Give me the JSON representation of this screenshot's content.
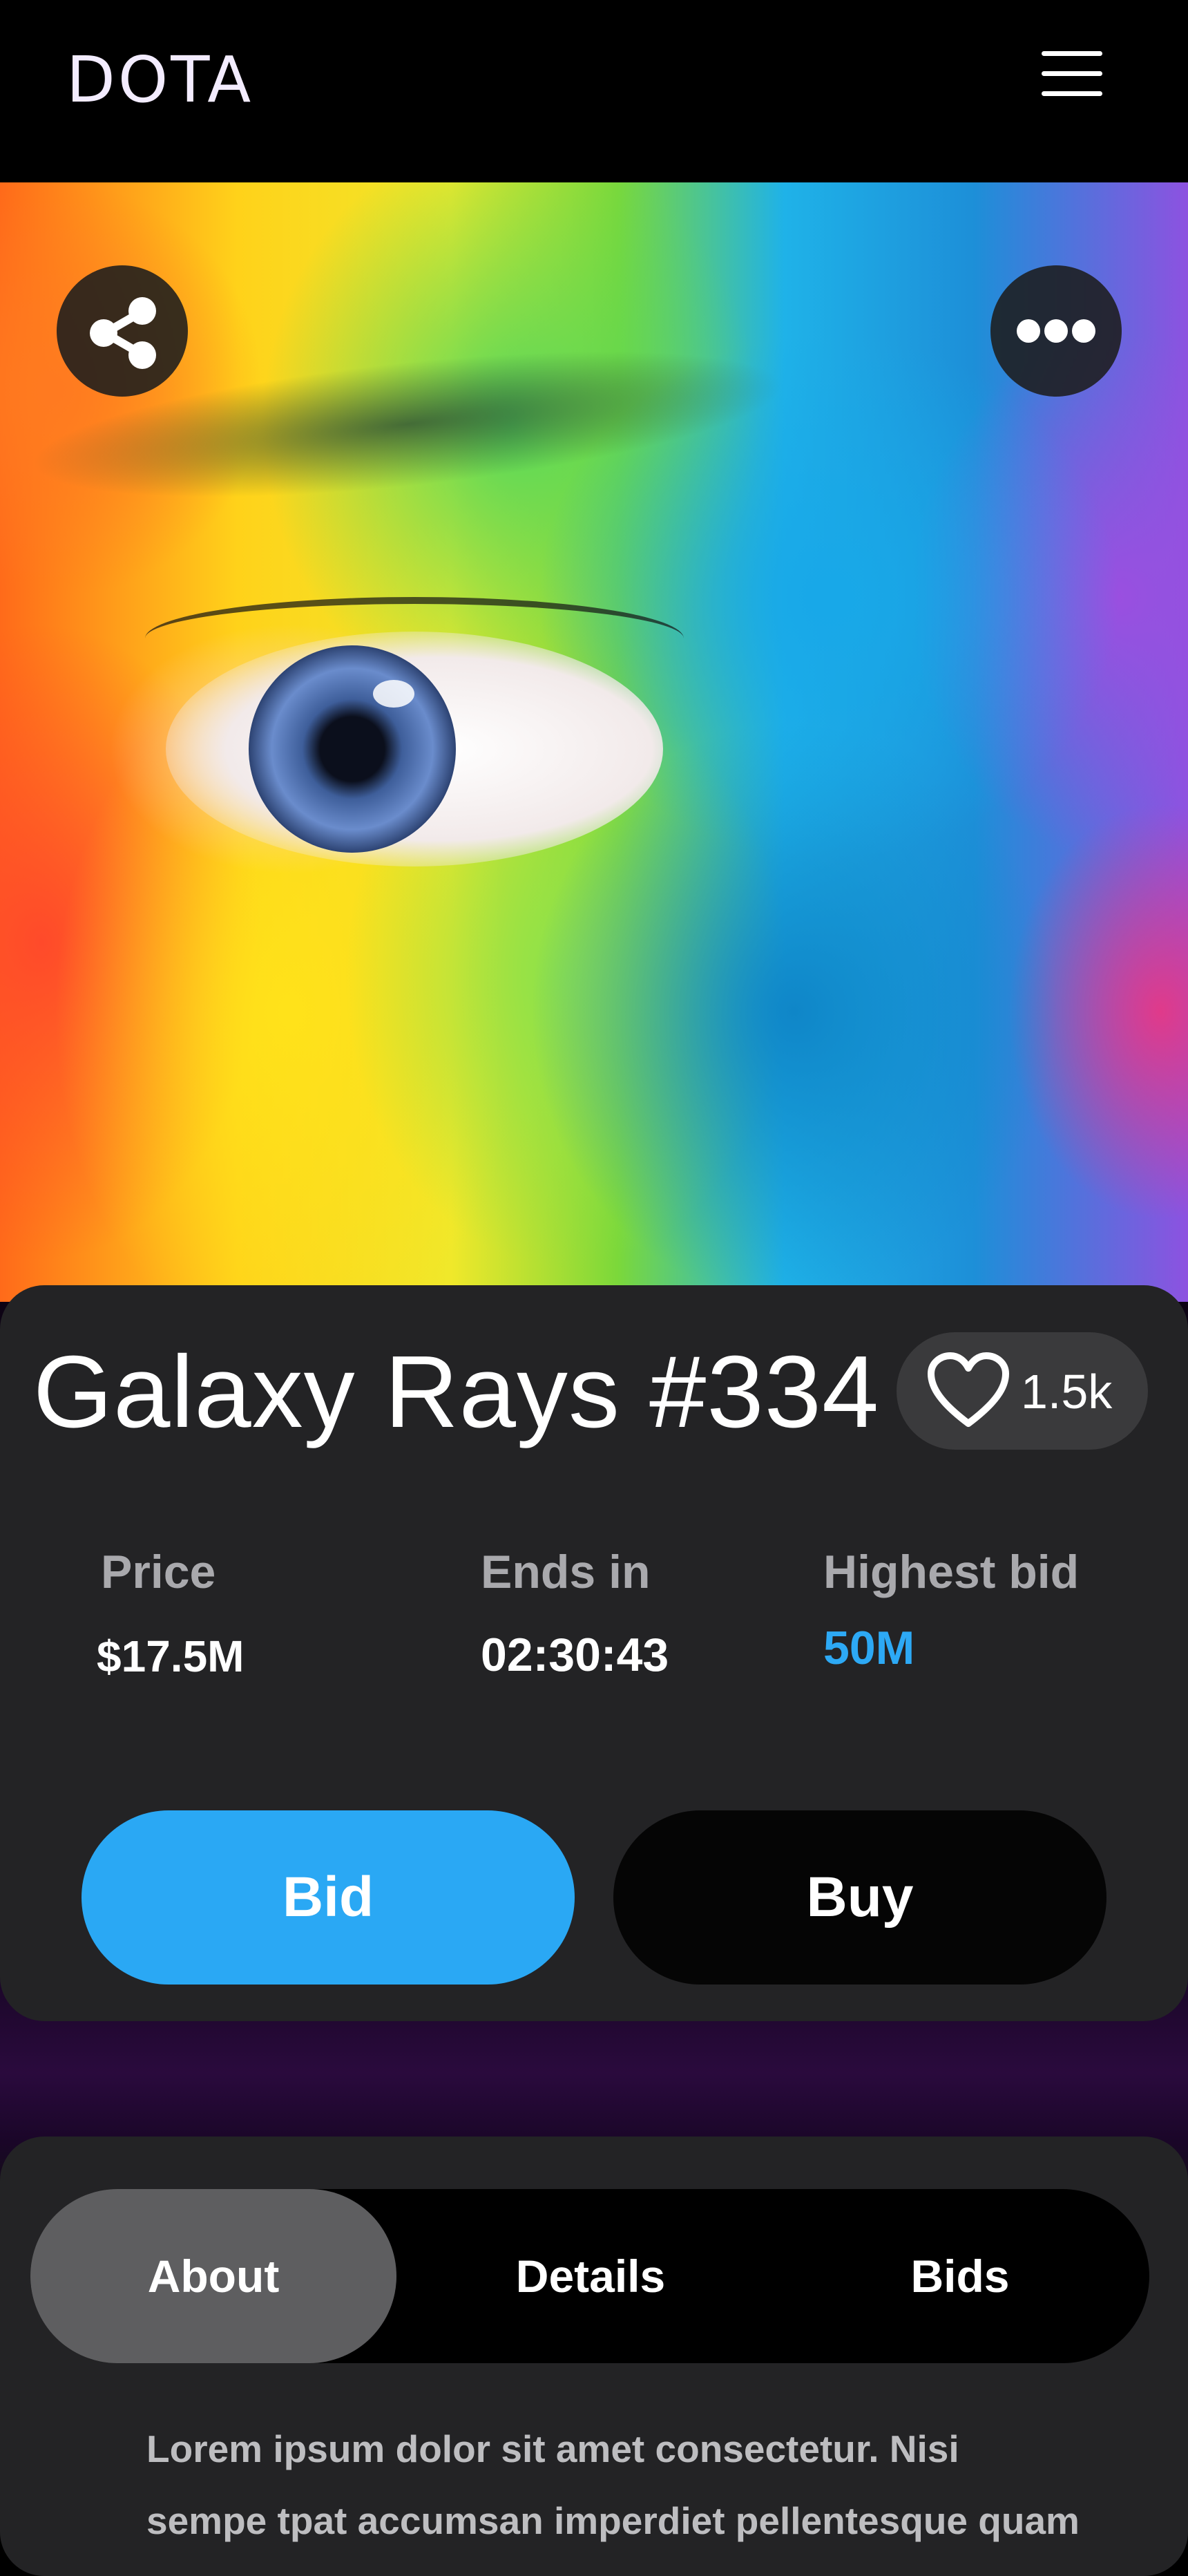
{
  "header": {
    "logo_text": "DOTA",
    "menu_icon": "hamburger-menu-icon"
  },
  "hero": {
    "share_icon": "share-icon",
    "more_icon": "more-dots-icon"
  },
  "item": {
    "title": "Galaxy Rays #334",
    "likes": "1.5k",
    "heart_icon": "heart-icon"
  },
  "stats": {
    "price_label": "Price",
    "price_value": "$17.5M",
    "ends_label": "Ends in",
    "ends_value": "02:30:43",
    "bid_label": "Highest bid",
    "bid_value": "50M"
  },
  "actions": {
    "bid_label": "Bid",
    "buy_label": "Buy"
  },
  "tabs": [
    {
      "label": "About",
      "active": true
    },
    {
      "label": "Details",
      "active": false
    },
    {
      "label": "Bids",
      "active": false
    }
  ],
  "about": {
    "text": "Lorem ipsum dolor sit amet consectetur. Nisi sempe tpat accumsan imperdiet pellentesque quam arcu."
  },
  "colors": {
    "accent": "#2aa8f4",
    "card": "#232325",
    "active_tab": "#5e5e60"
  }
}
